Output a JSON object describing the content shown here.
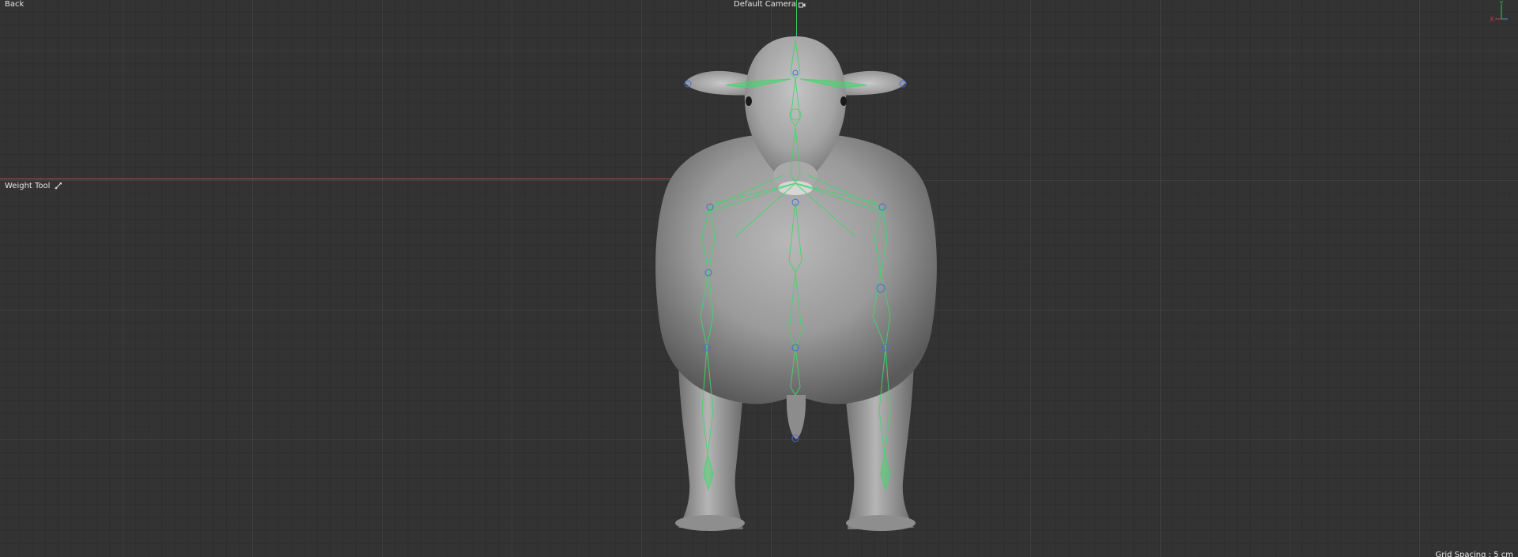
{
  "toolbar": {
    "back_label": "Back",
    "camera_label": "Default Camera",
    "tool_label": "Weight Tool"
  },
  "status": {
    "grid_spacing": "Grid Spacing : 5 cm"
  },
  "gizmo": {
    "x_label": "X",
    "y_label": "Y"
  },
  "icons": {
    "camera": "camera-icon",
    "weight_tool": "weight-paint-icon"
  },
  "colors": {
    "background": "#333333",
    "x_axis": "#d23a3a",
    "y_axis": "#3bc65a",
    "bones": "#3fd86a",
    "joints": "#4a6bd8"
  }
}
